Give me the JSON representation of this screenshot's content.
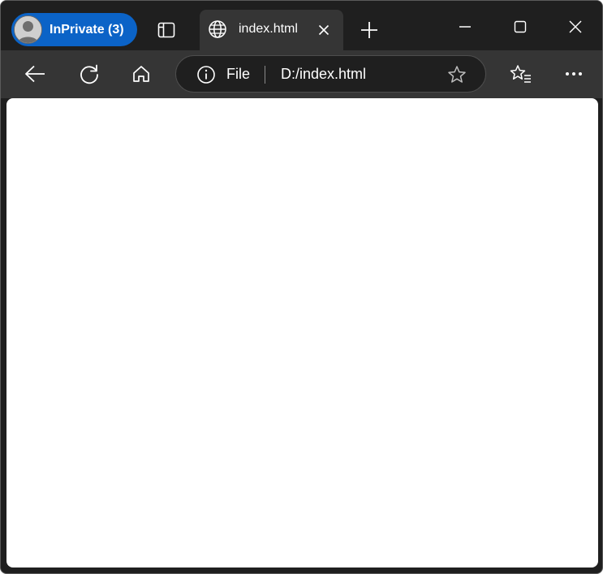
{
  "profile": {
    "label": "InPrivate (3)",
    "pill_color": "#0b63c7",
    "icon": "person-avatar-icon"
  },
  "tab_actions_icon": "vertical-tabs-icon",
  "tabs": [
    {
      "title": "index.html",
      "icon": "globe-icon",
      "close_icon": "close-icon",
      "active": true
    }
  ],
  "new_tab_icon": "plus-icon",
  "window_controls": [
    "minimize-icon",
    "maximize-icon",
    "close-icon"
  ],
  "toolbar": {
    "back_icon": "arrow-left-icon",
    "refresh_icon": "refresh-icon",
    "home_icon": "home-icon",
    "favorites_icon": "favorites-list-icon",
    "menu_icon": "more-horizontal-icon"
  },
  "address_bar": {
    "info_icon": "info-icon",
    "scheme_label": "File",
    "url": "D:/index.html",
    "favorite_icon": "star-outline-icon"
  },
  "theme": {
    "titlebar_bg": "#1f1f1f",
    "toolbar_bg": "#353535",
    "page_bg": "#ffffff"
  }
}
